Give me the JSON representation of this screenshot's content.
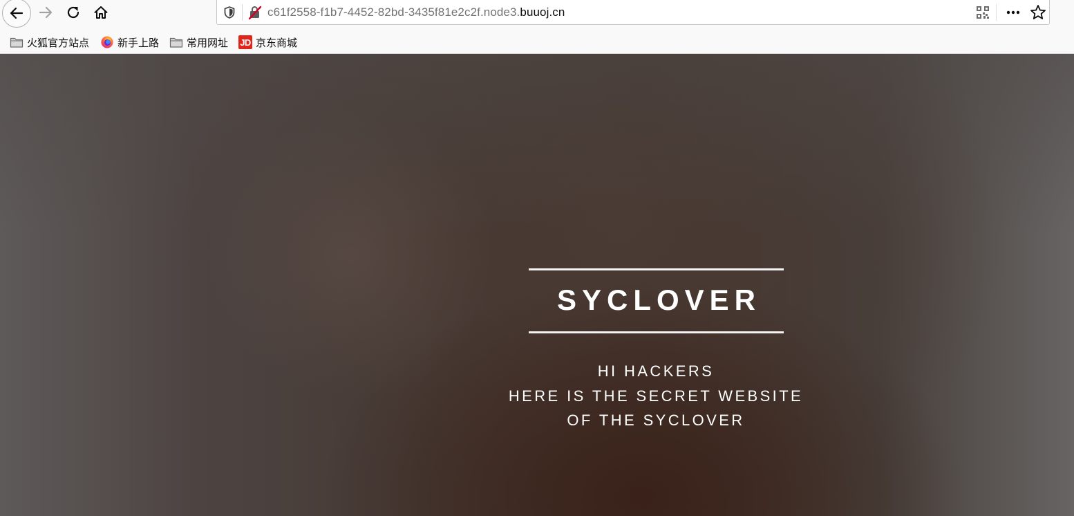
{
  "browser": {
    "url_prefix": "c61f2558-f1b7-4452-82bd-3435f81e2c2f.node3.",
    "url_domain": "buuoj.cn",
    "icons": {
      "back": "back-arrow-icon",
      "forward": "forward-arrow-icon",
      "reload": "reload-icon",
      "home": "home-icon",
      "shield": "tracking-shield-icon",
      "insecure": "insecure-lock-icon",
      "qr": "qr-code-icon",
      "more": "more-actions-icon",
      "bookmark": "bookmark-star-icon"
    }
  },
  "bookmarks": [
    {
      "label": "火狐官方站点",
      "icon": "folder-icon"
    },
    {
      "label": "新手上路",
      "icon": "firefox-icon"
    },
    {
      "label": "常用网址",
      "icon": "folder-icon"
    },
    {
      "label": "京东商城",
      "icon": "jd-icon",
      "icon_text": "JD"
    }
  ],
  "page": {
    "title": "SYCLOVER",
    "tagline_lines": [
      "HI HACKERS",
      "HERE IS THE SECRET WEBSITE",
      "OF THE SYCLOVER"
    ]
  },
  "colors": {
    "text": "#ffffff",
    "jd_red": "#e1251b",
    "background_dark": "#3a2219"
  }
}
